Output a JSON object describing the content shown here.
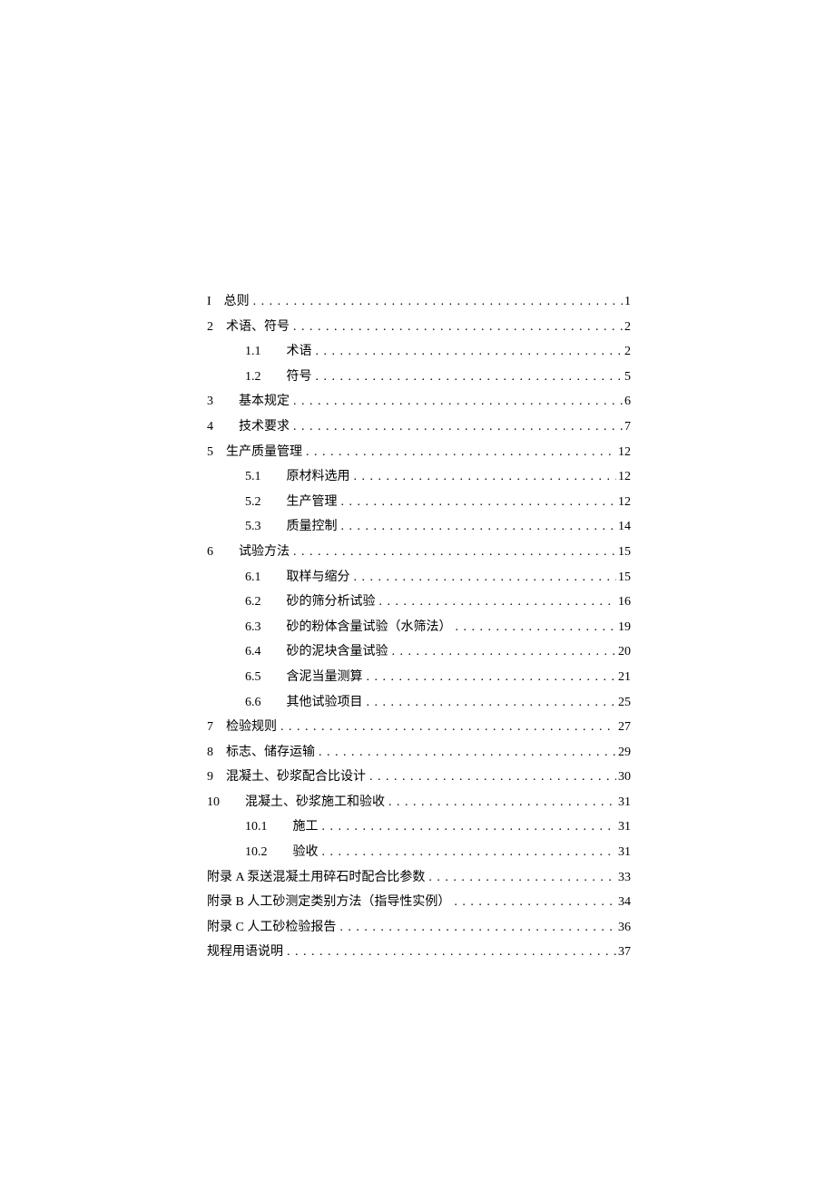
{
  "toc": {
    "items": [
      {
        "level": 0,
        "num": "I",
        "gap": "sm",
        "label": "总则",
        "page": "1"
      },
      {
        "level": 0,
        "num": "2",
        "gap": "sm",
        "label": "术语、符号",
        "page": "2"
      },
      {
        "level": 1,
        "num": "1.1",
        "gap": "wide",
        "label": "术语",
        "page": "2"
      },
      {
        "level": 1,
        "num": "1.2",
        "gap": "wide",
        "label": "符号",
        "page": "5"
      },
      {
        "level": 0,
        "num": "3",
        "gap": "wide",
        "label": "基本规定",
        "page": "6"
      },
      {
        "level": 0,
        "num": "4",
        "gap": "wide",
        "label": "技术要求",
        "page": "7"
      },
      {
        "level": 0,
        "num": "5",
        "gap": "sm",
        "label": "生产质量管理",
        "page": "12"
      },
      {
        "level": 1,
        "num": "5.1",
        "gap": "wide",
        "label": "原材料选用",
        "page": "12"
      },
      {
        "level": 1,
        "num": "5.2",
        "gap": "wide",
        "label": "生产管理",
        "page": "12"
      },
      {
        "level": 1,
        "num": "5.3",
        "gap": "wide",
        "label": "质量控制",
        "page": "14"
      },
      {
        "level": 0,
        "num": "6",
        "gap": "wide",
        "label": "试验方法",
        "page": "15"
      },
      {
        "level": 1,
        "num": "6.1",
        "gap": "wide",
        "label": "取样与缩分",
        "page": "15"
      },
      {
        "level": 1,
        "num": "6.2",
        "gap": "wide",
        "label": "砂的筛分析试验",
        "page": "16"
      },
      {
        "level": 1,
        "num": "6.3",
        "gap": "wide",
        "label": "砂的粉体含量试验（水筛法）",
        "page": "19"
      },
      {
        "level": 1,
        "num": "6.4",
        "gap": "wide",
        "label": "砂的泥块含量试验",
        "page": "20"
      },
      {
        "level": 1,
        "num": "6.5",
        "gap": "wide",
        "label": "含泥当量测算",
        "page": "21"
      },
      {
        "level": 1,
        "num": "6.6",
        "gap": "wide",
        "label": "其他试验项目",
        "page": "25"
      },
      {
        "level": 0,
        "num": "7",
        "gap": "sm",
        "label": "检验规则",
        "page": "27"
      },
      {
        "level": 0,
        "num": "8",
        "gap": "sm",
        "label": "标志、储存运输",
        "page": "29"
      },
      {
        "level": 0,
        "num": "9",
        "gap": "sm",
        "label": "混凝土、砂浆配合比设计",
        "page": "30"
      },
      {
        "level": 0,
        "num": "10",
        "gap": "wide",
        "label": "混凝土、砂浆施工和验收",
        "page": "31"
      },
      {
        "level": 1,
        "num": "10.1",
        "gap": "wide",
        "label": "施工",
        "page": "31"
      },
      {
        "level": 1,
        "num": "10.2",
        "gap": "wide",
        "label": "验收",
        "page": "31"
      },
      {
        "level": 0,
        "num": "",
        "gap": "none",
        "label": "附录 A 泵送混凝土用碎石时配合比参数",
        "page": "33"
      },
      {
        "level": 0,
        "num": "",
        "gap": "none",
        "label": "附录 B 人工砂测定类别方法（指导性实例）",
        "page": "34"
      },
      {
        "level": 0,
        "num": "",
        "gap": "none",
        "label": "附录 C 人工砂检验报告",
        "page": "36"
      },
      {
        "level": 0,
        "num": "",
        "gap": "none",
        "label": "规程用语说明",
        "page": "37"
      }
    ]
  }
}
